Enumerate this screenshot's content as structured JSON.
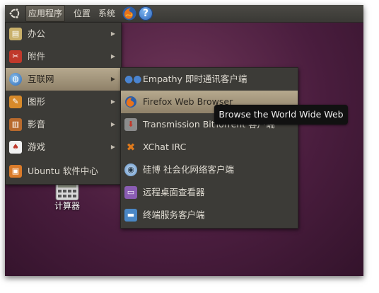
{
  "panel": {
    "applications_label": "应用程序",
    "places_label": "位置",
    "system_label": "系统",
    "help_glyph": "?"
  },
  "main_menu": {
    "items": [
      {
        "label": "办公",
        "icon": "office-icon",
        "has_submenu": true
      },
      {
        "label": "附件",
        "icon": "accessories-icon",
        "has_submenu": true
      },
      {
        "label": "互联网",
        "icon": "internet-icon",
        "has_submenu": true,
        "highlighted": true
      },
      {
        "label": "图形",
        "icon": "graphics-icon",
        "has_submenu": true
      },
      {
        "label": "影音",
        "icon": "sound-video-icon",
        "has_submenu": true
      },
      {
        "label": "游戏",
        "icon": "games-icon",
        "has_submenu": true
      },
      {
        "label": "Ubuntu 软件中心",
        "icon": "software-center-icon",
        "has_submenu": false
      }
    ],
    "arrow_glyph": "▶"
  },
  "internet_submenu": {
    "items": [
      {
        "label": "Empathy 即时通讯客户端",
        "icon": "empathy-icon"
      },
      {
        "label": "Firefox Web Browser",
        "icon": "firefox-icon",
        "highlighted": true
      },
      {
        "label": "Transmission BitTorrent 客户端",
        "icon": "transmission-icon"
      },
      {
        "label": "XChat IRC",
        "icon": "xchat-icon"
      },
      {
        "label": "硅博 社会化网络客户端",
        "icon": "gwibber-icon"
      },
      {
        "label": "远程桌面查看器",
        "icon": "remote-desktop-icon"
      },
      {
        "label": "终端服务客户端",
        "icon": "terminal-server-icon"
      }
    ]
  },
  "tooltip": {
    "text": "Browse the World Wide Web"
  },
  "desktop": {
    "icon_label": "计算器"
  },
  "colors": {
    "panel_bg": "#3f3e3a",
    "menu_bg": "#3c3b37",
    "highlight": "#a89b80",
    "desktop_bg": "#5a2a4c",
    "tooltip_bg": "#111111"
  }
}
